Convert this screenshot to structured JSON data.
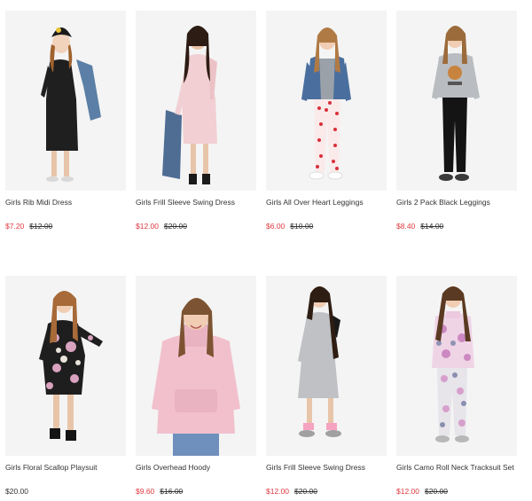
{
  "colors": {
    "sale_price": "#e0393f",
    "regular_price": "#333333",
    "photo_background": "#f4f4f4"
  },
  "products": [
    {
      "name": "Girls Rib Midi Dress",
      "price": "$7.20",
      "was_price": "$12.00",
      "image": "girl-black-rib-midi-dress-with-denim-jacket-and-beanie"
    },
    {
      "name": "Girls Frill Sleeve Swing Dress",
      "price": "$12.00",
      "was_price": "$20.00",
      "image": "girl-pink-frill-sleeve-swing-dress"
    },
    {
      "name": "Girls All Over Heart Leggings",
      "price": "$6.00",
      "was_price": "$10.00",
      "image": "girl-denim-jacket-heart-print-leggings"
    },
    {
      "name": "Girls 2 Pack Black Leggings",
      "price": "$8.40",
      "was_price": "$14.00",
      "image": "girl-grey-sweatshirt-black-leggings"
    },
    {
      "name": "Girls Floral Scallop Playsuit",
      "price": "$20.00",
      "was_price": "",
      "image": "girl-black-floral-playsuit"
    },
    {
      "name": "Girls Overhead Hoody",
      "price": "$9.60",
      "was_price": "$16.00",
      "image": "girl-pink-overhead-hoody"
    },
    {
      "name": "Girls Frill Sleeve Swing Dress",
      "price": "$12.00",
      "was_price": "$20.00",
      "image": "girl-grey-frill-sleeve-swing-dress"
    },
    {
      "name": "Girls Camo Roll Neck Tracksuit Set",
      "price": "$12.00",
      "was_price": "$20.00",
      "image": "girl-pink-camo-tracksuit"
    }
  ]
}
